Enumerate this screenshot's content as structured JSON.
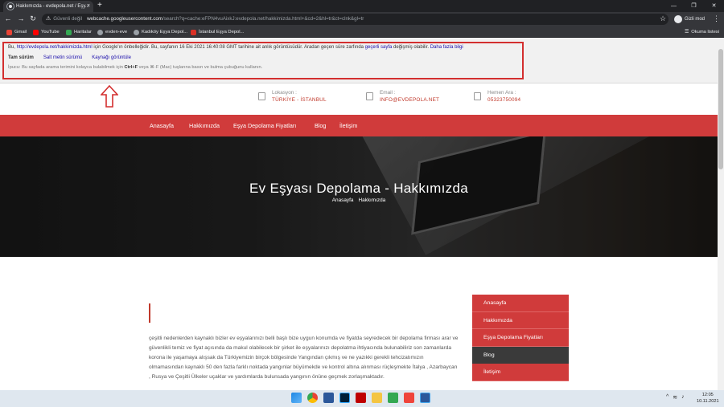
{
  "browser": {
    "tab_title": "Hakkımızda - evdepola.net / Eşy...",
    "close_glyph": "×",
    "new_tab_glyph": "+",
    "window_controls": [
      "—",
      "❐",
      "✕"
    ],
    "nav": {
      "back": "←",
      "forward": "→",
      "reload": "↻"
    },
    "omnibox": {
      "security_text": "Güvenli değil",
      "host": "webcache.googleusercontent.com",
      "path": "/search?q=cache:eFPN4vuAixkJ:evdepola.net/hakkimizda.html+&cd=2&hl=tr&ct=clnk&gl=tr"
    },
    "star_glyph": "☆",
    "profile_label": "Gizli mod",
    "menu_glyph": "⋮",
    "bookmarks": [
      {
        "label": "Gmail",
        "color": "#ea4335"
      },
      {
        "label": "YouTube",
        "color": "#ff0000"
      },
      {
        "label": "Haritalar",
        "color": "#34a853"
      },
      {
        "label": "evden-eve",
        "color": "#9aa0a6"
      },
      {
        "label": "Kadıköy Eşya Depol...",
        "color": "#9aa0a6"
      },
      {
        "label": "İstanbul Eşya Depol...",
        "color": "#d93025"
      }
    ],
    "reading_list": "Okuma listesi"
  },
  "cache_banner": {
    "line1_prefix": "Bu, ",
    "line1_url": "http://evdepola.net/hakkimizda.html",
    "line1_mid": " için Google'ın önbelleğidir. Bu, sayfanın 16 Eki 2021 16:40:08 GMT tarihine ait anlık görüntüsüdür. Aradan geçen süre zarfında ",
    "line1_link": "geçerli sayfa",
    "line1_after": " değişmiş olabilir. ",
    "line1_more": "Daha fazla bilgi",
    "links": [
      "Tam sürüm",
      "Salt metin sürümü",
      "Kaynağı görüntüle"
    ],
    "tip_prefix": "İpucu: Bu sayfada arama terimini kolayca bulabilmek için ",
    "tip_keys": "Ctrl+F",
    "tip_mid": " veya ⌘-F (Mac) tuşlarına basın ve bulma çubuğunu kullanın."
  },
  "site": {
    "contact": [
      {
        "label": "Lokasyon :",
        "value": "TÜRKİYE - İSTANBUL"
      },
      {
        "label": "Email :",
        "value": "INFO@EVDEPOLA.NET"
      },
      {
        "label": "Hemen Ara :",
        "value": "05323750094"
      }
    ],
    "nav": [
      "Anasayfa",
      "Hakkımızda",
      "Eşya Depolama Fiyatları",
      "Blog",
      "İletişim"
    ],
    "hero_title": "Ev Eşyası Depolama - Hakkımızda",
    "breadcrumbs": [
      "Anasayfa",
      "Hakkımızda"
    ],
    "body_text": "çeşitli nedenlerden kaynaklı bizler ev eşyalarınızı belli başlı bize uygun konumda ve fiyatda seyredecek bir depolama firması arar ve güvenlikli temiz ve fiyat açısında da makul olabilecek bir şirket ile eşyalarınızı depolatma ihtiyacında bulunabiliriz son zamanlarda korona ile yaşamaya alışsak da Türkiyemizin birçok bölgesinde Yangından çıkmış ve ne yazıkki gerekli tehcizatımızın olmamasından kaynaklı 50 den fazla farklı noktada yangınlar büyümekde ve kontrol altına alınması rüçleşmekte İtalya , Azarbaycan , Rusya ve Çeşitli Ülkeler uçaklar ve yardımlarda bulunsada yangının önüne geçmek zorlaşmaktadır.",
    "sidebar": [
      "Anasayfa",
      "Hakkımızda",
      "Eşya Depolama Fiyatları",
      "Blog",
      "İletişim"
    ],
    "sidebar_active_index": 3,
    "accent_color": "#d03b3b"
  },
  "taskbar": {
    "icons": [
      "windows-start-icon",
      "chrome-icon",
      "explorer-icon",
      "photoshop-icon",
      "filezilla-icon",
      "file-folder-icon",
      "notes-icon",
      "anydesk-icon",
      "word-icon"
    ],
    "time": "12:05",
    "date": "10.11.2021"
  }
}
